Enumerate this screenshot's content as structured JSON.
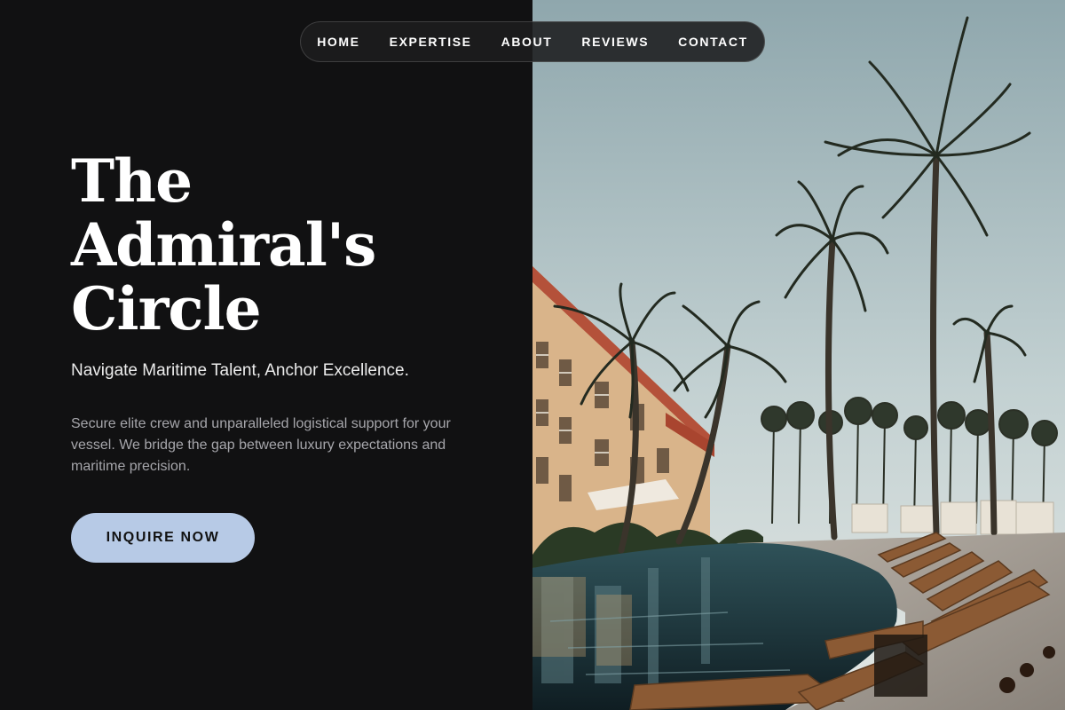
{
  "nav": {
    "items": [
      {
        "label": "HOME"
      },
      {
        "label": "EXPERTISE"
      },
      {
        "label": "ABOUT"
      },
      {
        "label": "REVIEWS"
      },
      {
        "label": "CONTACT"
      }
    ]
  },
  "hero": {
    "title_lines": [
      "The",
      "Admiral's",
      "Circle"
    ],
    "tagline": "Navigate Maritime Talent, Anchor Excellence.",
    "description": "Secure elite crew and unparalleled logistical support for your vessel. We bridge the gap between luxury expectations and maritime precision.",
    "cta_label": "INQUIRE NOW"
  },
  "colors": {
    "background": "#111112",
    "accent": "#b7cae6",
    "text_primary": "#ffffff",
    "text_muted": "#a6a6ab"
  },
  "media": {
    "image_subject": "resort-pool-palm-trees"
  }
}
